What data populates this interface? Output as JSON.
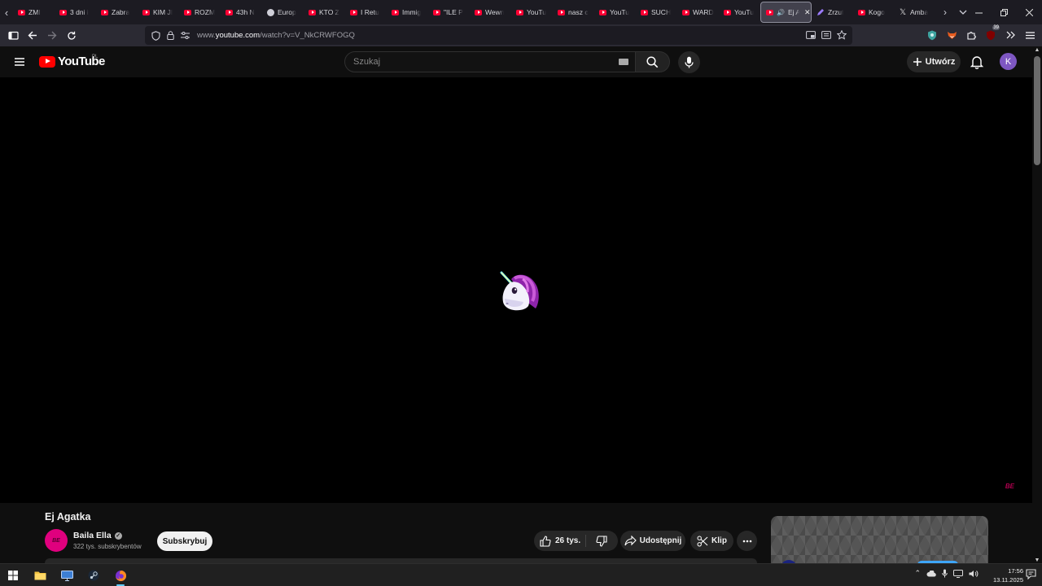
{
  "browser": {
    "tabs": [
      {
        "title": "ZMI",
        "type": "generic-red"
      },
      {
        "title": "3 dni i",
        "type": "yt"
      },
      {
        "title": "Zabra",
        "type": "yt"
      },
      {
        "title": "KIM JI",
        "type": "yt"
      },
      {
        "title": "ROZM",
        "type": "yt"
      },
      {
        "title": "43h N",
        "type": "yt"
      },
      {
        "title": "Europ",
        "type": "generic"
      },
      {
        "title": "KTO Z",
        "type": "yt"
      },
      {
        "title": "I Retu",
        "type": "yt"
      },
      {
        "title": "Immig",
        "type": "yt"
      },
      {
        "title": "\"ILE P",
        "type": "yt"
      },
      {
        "title": "Wewn",
        "type": "yt"
      },
      {
        "title": "YouTu",
        "type": "yt"
      },
      {
        "title": "nasz c",
        "type": "yt"
      },
      {
        "title": "YouTu",
        "type": "yt"
      },
      {
        "title": "SUCH",
        "type": "yt"
      },
      {
        "title": "WARD",
        "type": "yt"
      },
      {
        "title": "YouTu",
        "type": "yt"
      }
    ],
    "active_tab": {
      "title": "Ej A",
      "type": "yt"
    },
    "tabs_after": [
      {
        "title": "Zrzut",
        "type": "pen"
      },
      {
        "title": "Kogo",
        "type": "yt"
      },
      {
        "title": "Amba",
        "type": "x"
      }
    ],
    "url_prefix": "www.",
    "url_host": "youtube.com",
    "url_path": "/watch?v=V_NkCRWFOGQ",
    "extension_badge": "39"
  },
  "youtube": {
    "logo_text": "YouTube",
    "country_code": "PL",
    "search_placeholder": "Szukaj",
    "create_label": "Utwórz",
    "avatar_letter": "K",
    "watermark": "BE",
    "video": {
      "title": "Ej Agatka",
      "channel_name": "Baila Ella",
      "channel_initials": "BE",
      "subscribers": "322 tys. subskrybentów",
      "subscribe_label": "Subskrybuj",
      "likes": "26 tys.",
      "share_label": "Udostępnij",
      "clip_label": "Klip"
    }
  },
  "taskbar": {
    "time": "17:56",
    "date": "13.11.2025",
    "accent": "#60cdff"
  }
}
